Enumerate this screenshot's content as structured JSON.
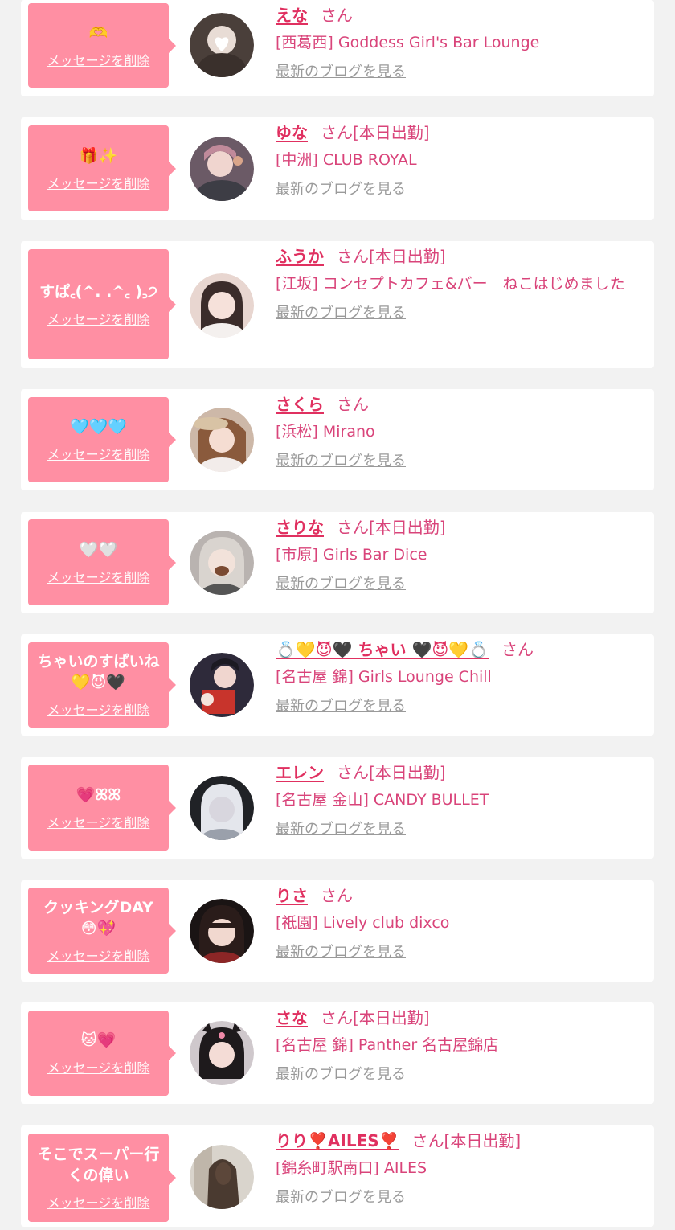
{
  "common": {
    "delete_label": "メッセージを削除",
    "blog_label": "最新のブログを見る",
    "san": "さん",
    "today": "[本日出勤]"
  },
  "entries": [
    {
      "message": "🫶",
      "name": "えな",
      "today": false,
      "shop": "[西葛西] Goddess Girl's Bar Lounge"
    },
    {
      "message": "🎁✨",
      "name": "ゆな",
      "today": true,
      "shop": "[中洲] CLUB ROYAL"
    },
    {
      "message": "すぱ꜀(^. .^꜀ )꜆੭",
      "name": "ふうか",
      "today": true,
      "shop": "[江坂] コンセプトカフェ&バー　ねこはじめました"
    },
    {
      "message": "🩵🩵🩵",
      "name": "さくら",
      "today": false,
      "shop": "[浜松] Mirano"
    },
    {
      "message": "🤍🤍",
      "name": "さりな",
      "today": true,
      "shop": "[市原] Girls Bar Dice"
    },
    {
      "message": "ちゃいのすぱいね\n💛😈🖤",
      "name": "💍💛😈🖤 ちゃい 🖤😈💛💍",
      "today": false,
      "shop": "[名古屋 錦] Girls Lounge Chill"
    },
    {
      "message": "💗ꕤꕤ",
      "name": "エレン",
      "today": true,
      "shop": "[名古屋 金山] CANDY BULLET"
    },
    {
      "message": "クッキングDAY\n😳💖",
      "name": "りさ",
      "today": false,
      "shop": "[祇園] Lively club dixco"
    },
    {
      "message": "🐱💗",
      "name": "さな",
      "today": true,
      "shop": "[名古屋 錦] Panther 名古屋錦店"
    },
    {
      "message": "そこでスーパー行\nくの偉い",
      "name": "りり❣️AILES❣️",
      "today": true,
      "shop": "[錦糸町駅南口] AILES"
    }
  ],
  "colors": {
    "bubble": "#ff8fa3",
    "name": "#e03060",
    "text": "#d9447a",
    "blog": "#9a9a9a",
    "background": "#f2f2f2"
  }
}
